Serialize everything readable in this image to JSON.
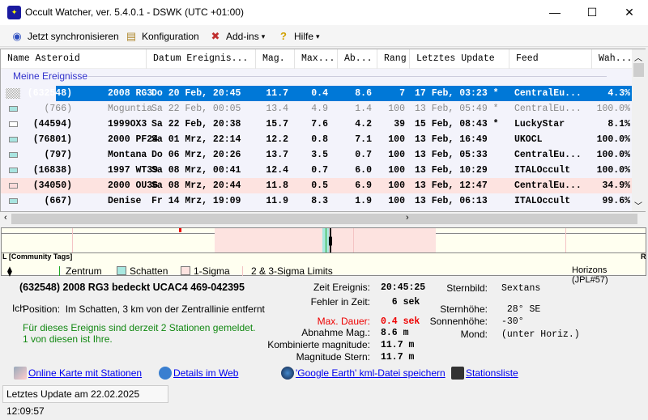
{
  "window": {
    "title": "Occult Watcher, ver. 5.4.0.1 - DSWK (UTC +01:00)",
    "minimize": "—",
    "maximize": "☐",
    "close": "✕"
  },
  "toolbar": {
    "sync": "Jetzt synchronisieren",
    "config": "Konfiguration",
    "addins": "Add-ins",
    "help": "Hilfe",
    "dropdown": "▾"
  },
  "list": {
    "columns": [
      "Name Asteroid",
      "Datum Ereignis...",
      "Mag.",
      "Max...",
      "Ab...",
      "Rang",
      "Letztes Update",
      "Feed",
      "Wah..."
    ],
    "group": "Meine Ereignisse",
    "rows": [
      {
        "num": "(632548)",
        "name": "2008 RG3",
        "date": "Do 20 Feb, 20:45",
        "mag": "11.7",
        "max": "0.4",
        "ab": "8.6",
        "rang": "7",
        "update": "17 Feb, 03:23 *",
        "feed": "CentralEu...",
        "wah": "4.3%",
        "style": "sel",
        "swatch": "checker"
      },
      {
        "num": "(766)",
        "name": "Moguntia",
        "date": "Sa 22 Feb, 00:05",
        "mag": "13.4",
        "max": "4.9",
        "ab": "1.4",
        "rang": "100",
        "update": "13 Feb, 05:49 *",
        "feed": "CentralEu...",
        "wah": "100.0%",
        "style": "gray",
        "swatch": "#a8e4e0"
      },
      {
        "num": "(44594)",
        "name": "1999OX3",
        "date": "Sa 22 Feb, 20:38",
        "mag": "15.7",
        "max": "7.6",
        "ab": "4.2",
        "rang": "39",
        "update": "15 Feb, 08:43 *",
        "feed": "LuckyStar",
        "wah": "8.1%",
        "style": "",
        "swatch": "#ffffff"
      },
      {
        "num": "(76801)",
        "name": "2000 PF24",
        "date": "Sa 01 Mrz, 22:14",
        "mag": "12.2",
        "max": "0.8",
        "ab": "7.1",
        "rang": "100",
        "update": "13 Feb, 16:49",
        "feed": "UKOCL",
        "wah": "100.0%",
        "style": "",
        "swatch": "#a8e4e0"
      },
      {
        "num": "(797)",
        "name": "Montana",
        "date": "Do 06 Mrz, 20:26",
        "mag": "13.7",
        "max": "3.5",
        "ab": "0.7",
        "rang": "100",
        "update": "13 Feb, 05:33",
        "feed": "CentralEu...",
        "wah": "100.0%",
        "style": "",
        "swatch": "#a8e4e0"
      },
      {
        "num": "(16838)",
        "name": "1997 WT39",
        "date": "Sa 08 Mrz, 00:41",
        "mag": "12.4",
        "max": "0.7",
        "ab": "6.0",
        "rang": "100",
        "update": "13 Feb, 10:29",
        "feed": "ITALOccult",
        "wah": "100.0%",
        "style": "",
        "swatch": "#a8e4e0"
      },
      {
        "num": "(34050)",
        "name": "2000 OU36",
        "date": "Sa 08 Mrz, 20:44",
        "mag": "11.8",
        "max": "0.5",
        "ab": "6.9",
        "rang": "100",
        "update": "13 Feb, 12:47",
        "feed": "CentralEu...",
        "wah": "34.9%",
        "style": "pink",
        "swatch": "#fadada"
      },
      {
        "num": "(667)",
        "name": "Denise",
        "date": "Fr 14 Mrz, 19:09",
        "mag": "11.9",
        "max": "8.3",
        "ab": "1.9",
        "rang": "100",
        "update": "13 Feb, 06:13",
        "feed": "ITALOccult",
        "wah": "99.6%",
        "style": "",
        "swatch": "#a8e4e0"
      }
    ]
  },
  "chart": {
    "left": "L",
    "right": "R",
    "tags": "[Community Tags]",
    "legend": {
      "me": "Ich",
      "center": "Zentrum",
      "shadow": "Schatten",
      "sigma1": "1-Sigma",
      "sigma23": "2 & 3-Sigma Limits",
      "source": "Horizons (JPL#57)"
    },
    "colors": {
      "shadow": "#a8e8e0",
      "sigma1": "#fde3e0",
      "center": "#22aa22"
    }
  },
  "details": {
    "title": "(632548) 2008 RG3 bedeckt UCAC4 469-042395",
    "position_label": "Position:",
    "position": "Im Schatten, 3 km von der Zentrallinie entfernt",
    "stations1": "Für dieses Ereignis sind derzeit 2 Stationen gemeldet.",
    "stations2": "1 von diesen ist Ihre.",
    "fields": [
      [
        "Zeit Ereignis:",
        "20:45:25"
      ],
      [
        "Fehler in Zeit:",
        "  6 sek"
      ],
      [
        "Max. Dauer:",
        "0.4 sek"
      ],
      [
        "Abnahme Mag.:",
        "8.6 m"
      ],
      [
        "Kombinierte magnitude:",
        "11.7 m"
      ],
      [
        "Magnitude Stern:",
        "11.7 m"
      ]
    ],
    "right": [
      [
        "Sternbild:",
        "Sextans"
      ],
      [
        "Sternhöhe:",
        " 28° SE"
      ],
      [
        "Sonnenhöhe:",
        "-30°"
      ],
      [
        "Mond:",
        "(unter Horiz.)"
      ]
    ],
    "links": [
      "Online Karte mit Stationen",
      "Details im Web",
      "'Google Earth' kml-Datei speichern",
      "Stationsliste"
    ]
  },
  "status": "Letztes Update am 22.02.2025 12:09:57"
}
